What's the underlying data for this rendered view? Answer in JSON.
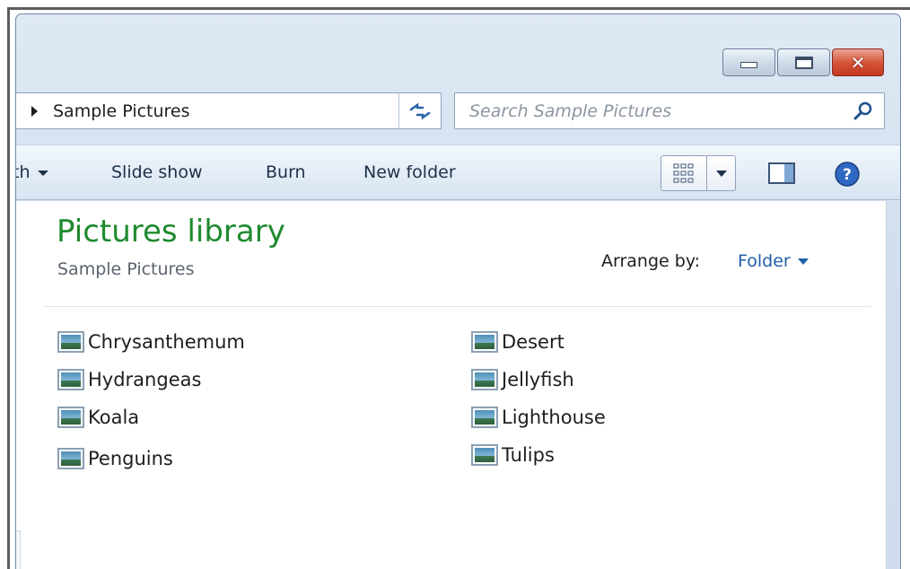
{
  "address": {
    "crumb": "Sample Pictures"
  },
  "search": {
    "placeholder": "Search Sample Pictures"
  },
  "toolbar": {
    "partial_item": "th",
    "slideshow": "Slide show",
    "burn": "Burn",
    "new_folder": "New folder"
  },
  "library": {
    "title": "Pictures library",
    "subtitle": "Sample Pictures",
    "arrange_label": "Arrange by:",
    "arrange_value": "Folder"
  },
  "files": {
    "left": [
      "Chrysanthemum",
      "Hydrangeas",
      "Koala",
      "Penguins"
    ],
    "right": [
      "Desert",
      "Jellyfish",
      "Lighthouse",
      "Tulips"
    ]
  },
  "colors": {
    "title_green": "#1f8a2e",
    "link_blue": "#1f5fa8",
    "close_red": "#c2381f"
  },
  "icons": [
    "minimize-icon",
    "maximize-icon",
    "close-icon",
    "refresh-icon",
    "search-icon",
    "view-grid-icon",
    "preview-pane-icon",
    "help-icon",
    "picture-file-icon"
  ]
}
